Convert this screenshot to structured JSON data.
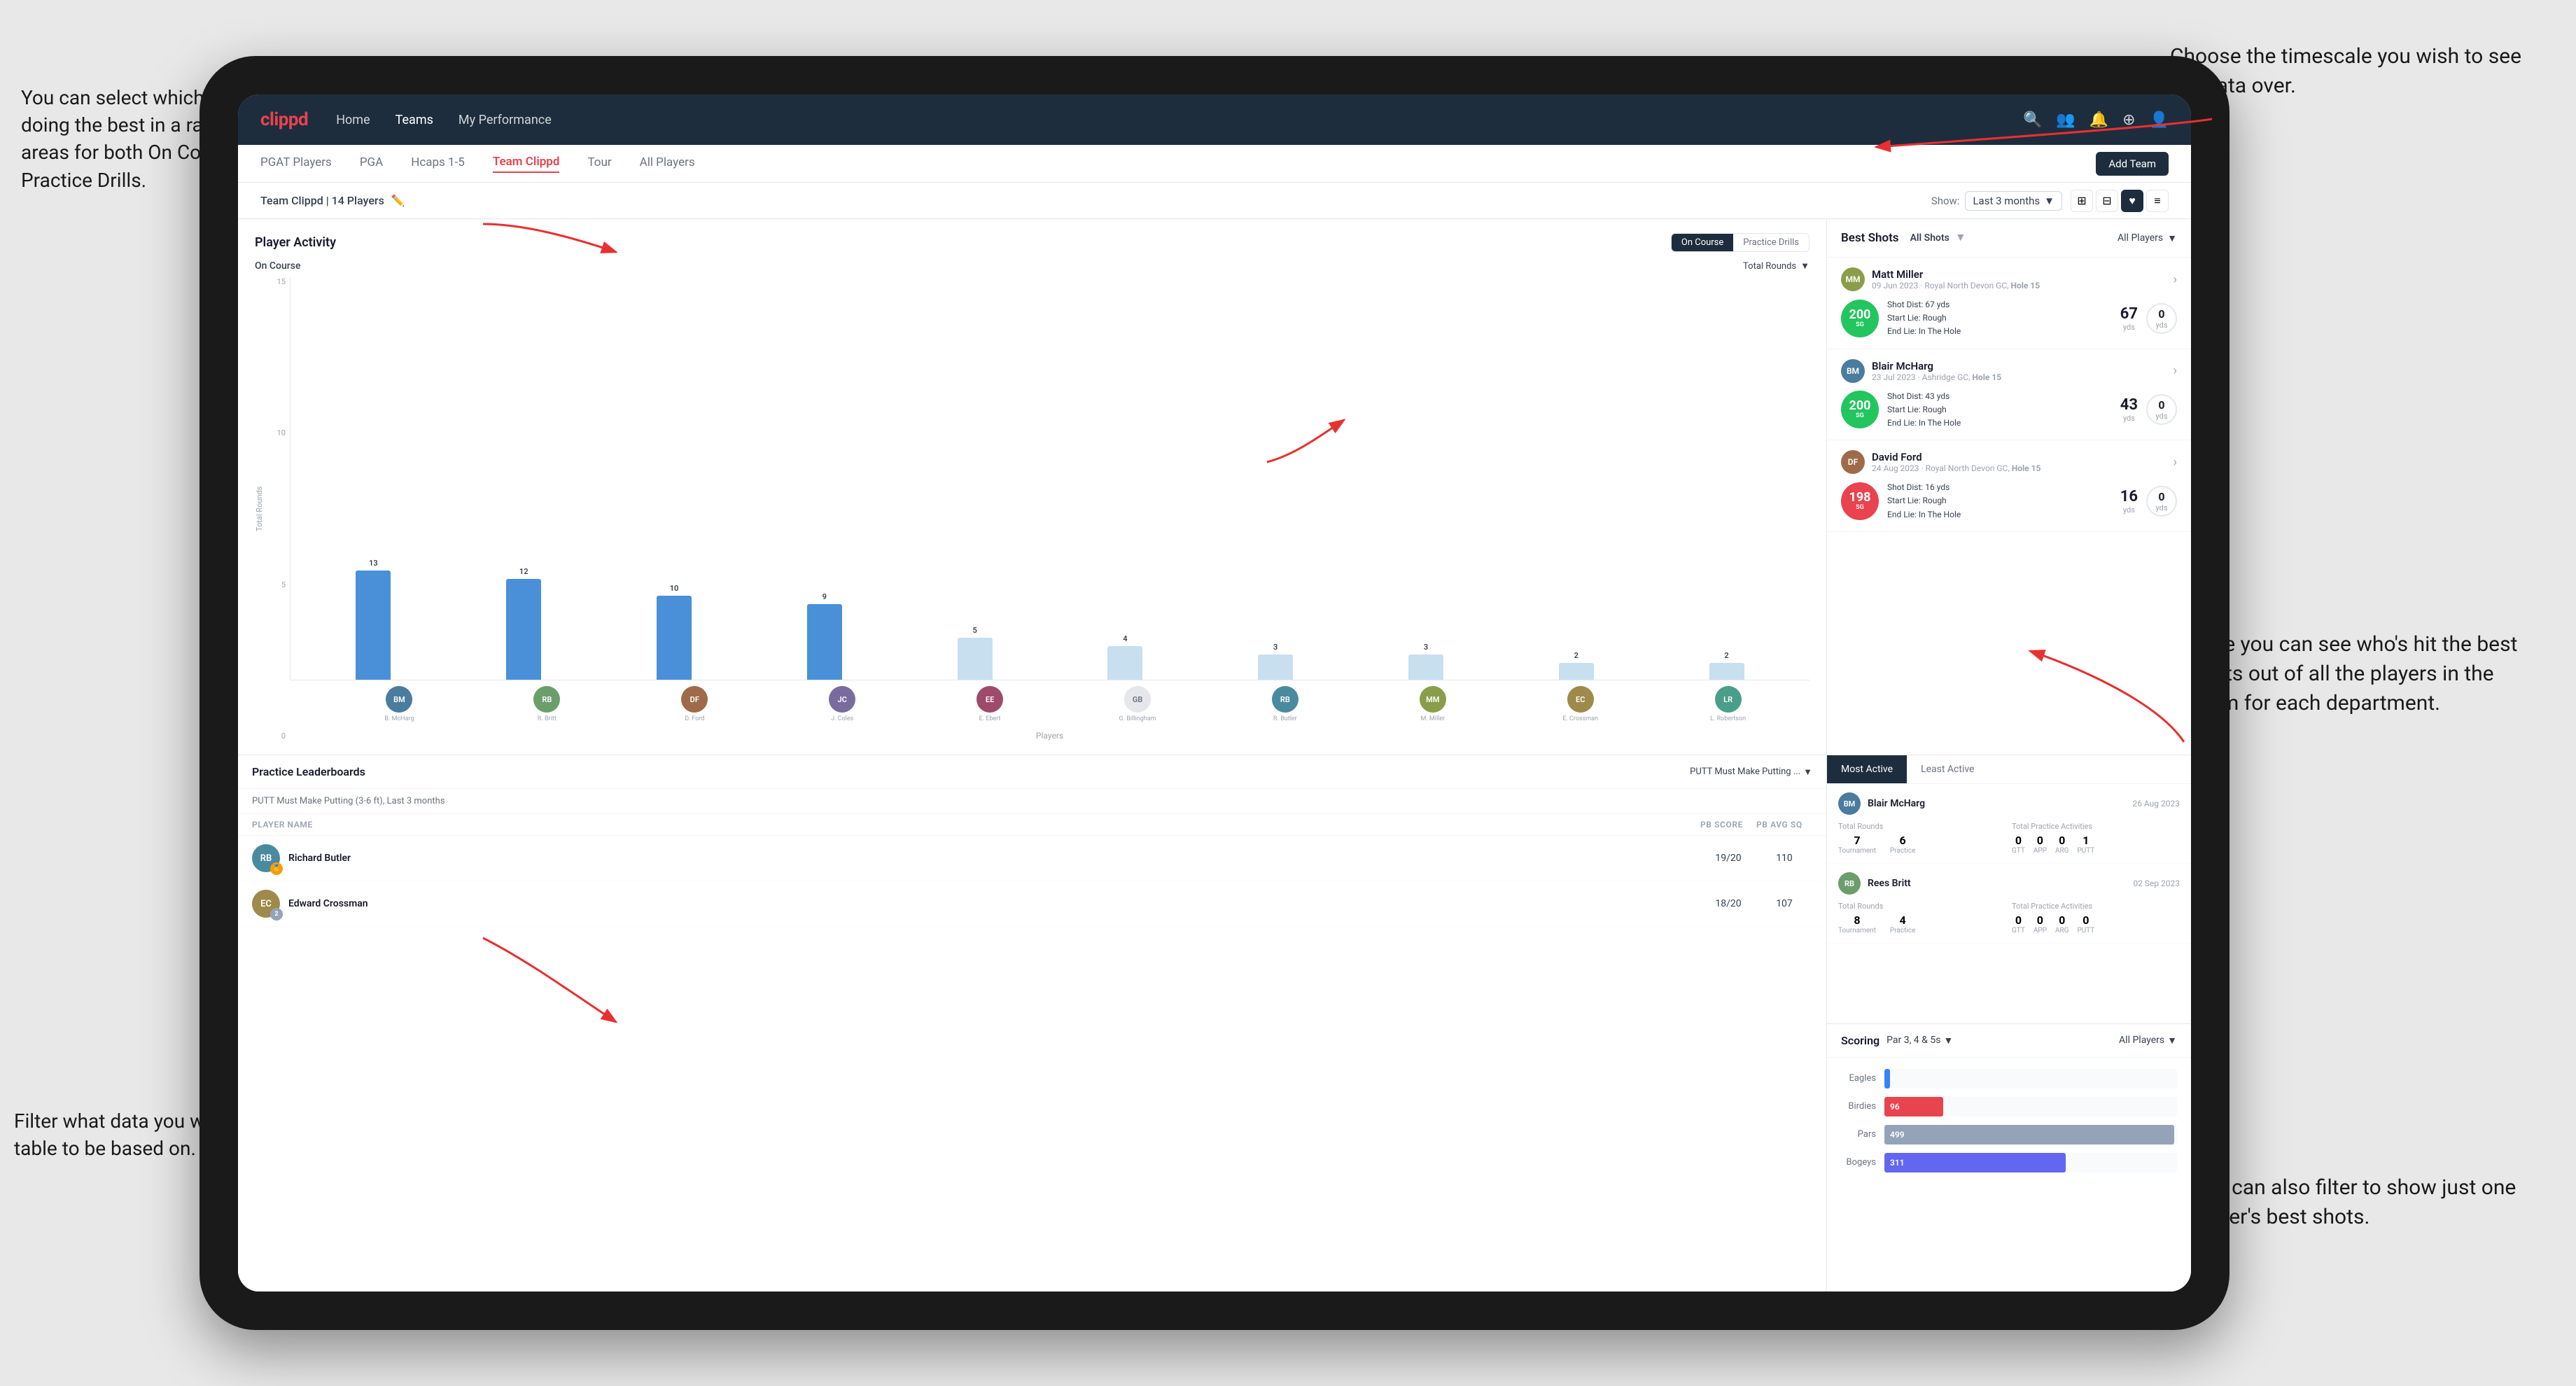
{
  "annotations": {
    "top_right": "Choose the timescale you\nwish to see the data over.",
    "top_left": "You can select which player is\ndoing the best in a range of\nareas for both On Course and\nPractice Drills.",
    "bottom_left": "Filter what data you wish the\ntable to be based on.",
    "bottom_right_1": "Here you can see who's hit\nthe best shots out of all the\nplayers in the team for\neach department.",
    "bottom_right_2": "You can also filter to show\njust one player's best shots."
  },
  "nav": {
    "logo": "clippd",
    "items": [
      "Home",
      "Teams",
      "My Performance"
    ],
    "icons": [
      "🔍",
      "👤",
      "🔔",
      "⊕",
      "👤"
    ]
  },
  "sub_tabs": {
    "items": [
      "PGAT Players",
      "PGA",
      "Hcaps 1-5",
      "Team Clippd",
      "Tour",
      "All Players"
    ],
    "active": "Team Clippd",
    "add_button": "Add Team"
  },
  "team_header": {
    "name": "Team Clippd | 14 Players",
    "show_label": "Show:",
    "show_value": "Last 3 months",
    "view_icons": [
      "grid",
      "grid2",
      "heart",
      "list"
    ]
  },
  "player_activity": {
    "title": "Player Activity",
    "tabs": [
      "On Course",
      "Practice Drills"
    ],
    "active_tab": "On Course",
    "section_title": "On Course",
    "chart_dropdown": "Total Rounds",
    "y_axis": [
      "15",
      "10",
      "5",
      "0"
    ],
    "y_label": "Total Rounds",
    "players_label": "Players",
    "bars": [
      {
        "name": "B. McHarg",
        "value": 13,
        "initials": "BM"
      },
      {
        "name": "R. Britt",
        "value": 12,
        "initials": "RB"
      },
      {
        "name": "D. Ford",
        "value": 10,
        "initials": "DF"
      },
      {
        "name": "J. Coles",
        "value": 9,
        "initials": "JC"
      },
      {
        "name": "E. Ebert",
        "value": 5,
        "initials": "EE"
      },
      {
        "name": "G. Billingham",
        "value": 4,
        "initials": "GB"
      },
      {
        "name": "R. Butler",
        "value": 3,
        "initials": "RB"
      },
      {
        "name": "M. Miller",
        "value": 3,
        "initials": "MM"
      },
      {
        "name": "E. Crossman",
        "value": 2,
        "initials": "EC"
      },
      {
        "name": "L. Robertson",
        "value": 2,
        "initials": "LR"
      }
    ]
  },
  "best_shots": {
    "title": "Best Shots",
    "toggle": [
      "All Shots",
      ""
    ],
    "filter": "All Players",
    "shots": [
      {
        "player": "Matt Miller",
        "date": "09 Jun 2023",
        "course": "Royal North Devon GC",
        "hole": "Hole 15",
        "badge_color": "green",
        "badge_num": "200",
        "badge_label": "SG",
        "shot_dist": "Shot Dist: 67 yds",
        "start_lie": "Start Lie: Rough",
        "end_lie": "End Lie: In The Hole",
        "stat1_num": "67",
        "stat1_unit": "yds",
        "stat2_num": "0",
        "stat2_unit": "yds",
        "initials": "MM"
      },
      {
        "player": "Blair McHarg",
        "date": "23 Jul 2023",
        "course": "Ashridge GC",
        "hole": "Hole 15",
        "badge_color": "green",
        "badge_num": "200",
        "badge_label": "SG",
        "shot_dist": "Shot Dist: 43 yds",
        "start_lie": "Start Lie: Rough",
        "end_lie": "End Lie: In The Hole",
        "stat1_num": "43",
        "stat1_unit": "yds",
        "stat2_num": "0",
        "stat2_unit": "yds",
        "initials": "BM"
      },
      {
        "player": "David Ford",
        "date": "24 Aug 2023",
        "course": "Royal North Devon GC",
        "hole": "Hole 15",
        "badge_color": "pink",
        "badge_num": "198",
        "badge_label": "SG",
        "shot_dist": "Shot Dist: 16 yds",
        "start_lie": "Start Lie: Rough",
        "end_lie": "End Lie: In The Hole",
        "stat1_num": "16",
        "stat1_unit": "yds",
        "stat2_num": "0",
        "stat2_unit": "yds",
        "initials": "DF"
      }
    ]
  },
  "practice_leaderboards": {
    "title": "Practice Leaderboards",
    "dropdown": "PUTT Must Make Putting ...",
    "subtitle": "PUTT Must Make Putting (3-6 ft), Last 3 months",
    "columns": [
      "PLAYER NAME",
      "PB SCORE",
      "PB AVG SQ"
    ],
    "players": [
      {
        "name": "Richard Butler",
        "initials": "RB",
        "rank": 1,
        "score": "19/20",
        "avg": "110"
      },
      {
        "name": "Edward Crossman",
        "initials": "EC",
        "rank": 2,
        "score": "18/20",
        "avg": "107"
      }
    ]
  },
  "most_active": {
    "tabs": [
      "Most Active",
      "Least Active"
    ],
    "active_tab": "Most Active",
    "items": [
      {
        "player": "Blair McHarg",
        "date": "26 Aug 2023",
        "initials": "BM",
        "rounds_label": "Total Rounds",
        "tournament": "7",
        "practice": "6",
        "practice_label": "Total Practice Activities",
        "gtt": "0",
        "app": "0",
        "arg": "0",
        "putt": "1"
      },
      {
        "player": "Rees Britt",
        "date": "02 Sep 2023",
        "initials": "RB",
        "rounds_label": "Total Rounds",
        "tournament": "8",
        "practice": "4",
        "practice_label": "Total Practice Activities",
        "gtt": "0",
        "app": "0",
        "arg": "0",
        "putt": "0"
      }
    ]
  },
  "scoring": {
    "title": "Scoring",
    "dropdown": "Par 3, 4 & 5s",
    "filter": "All Players",
    "rows": [
      {
        "label": "Eagles",
        "value": 3,
        "max": 500,
        "color": "#3b82f6"
      },
      {
        "label": "Birdies",
        "value": 96,
        "max": 500,
        "color": "#e8434e"
      },
      {
        "label": "Pars",
        "value": 499,
        "max": 500,
        "color": "#94a3b8"
      },
      {
        "label": "Bogeys",
        "value": 311,
        "max": 500,
        "color": "#f97316"
      }
    ]
  }
}
